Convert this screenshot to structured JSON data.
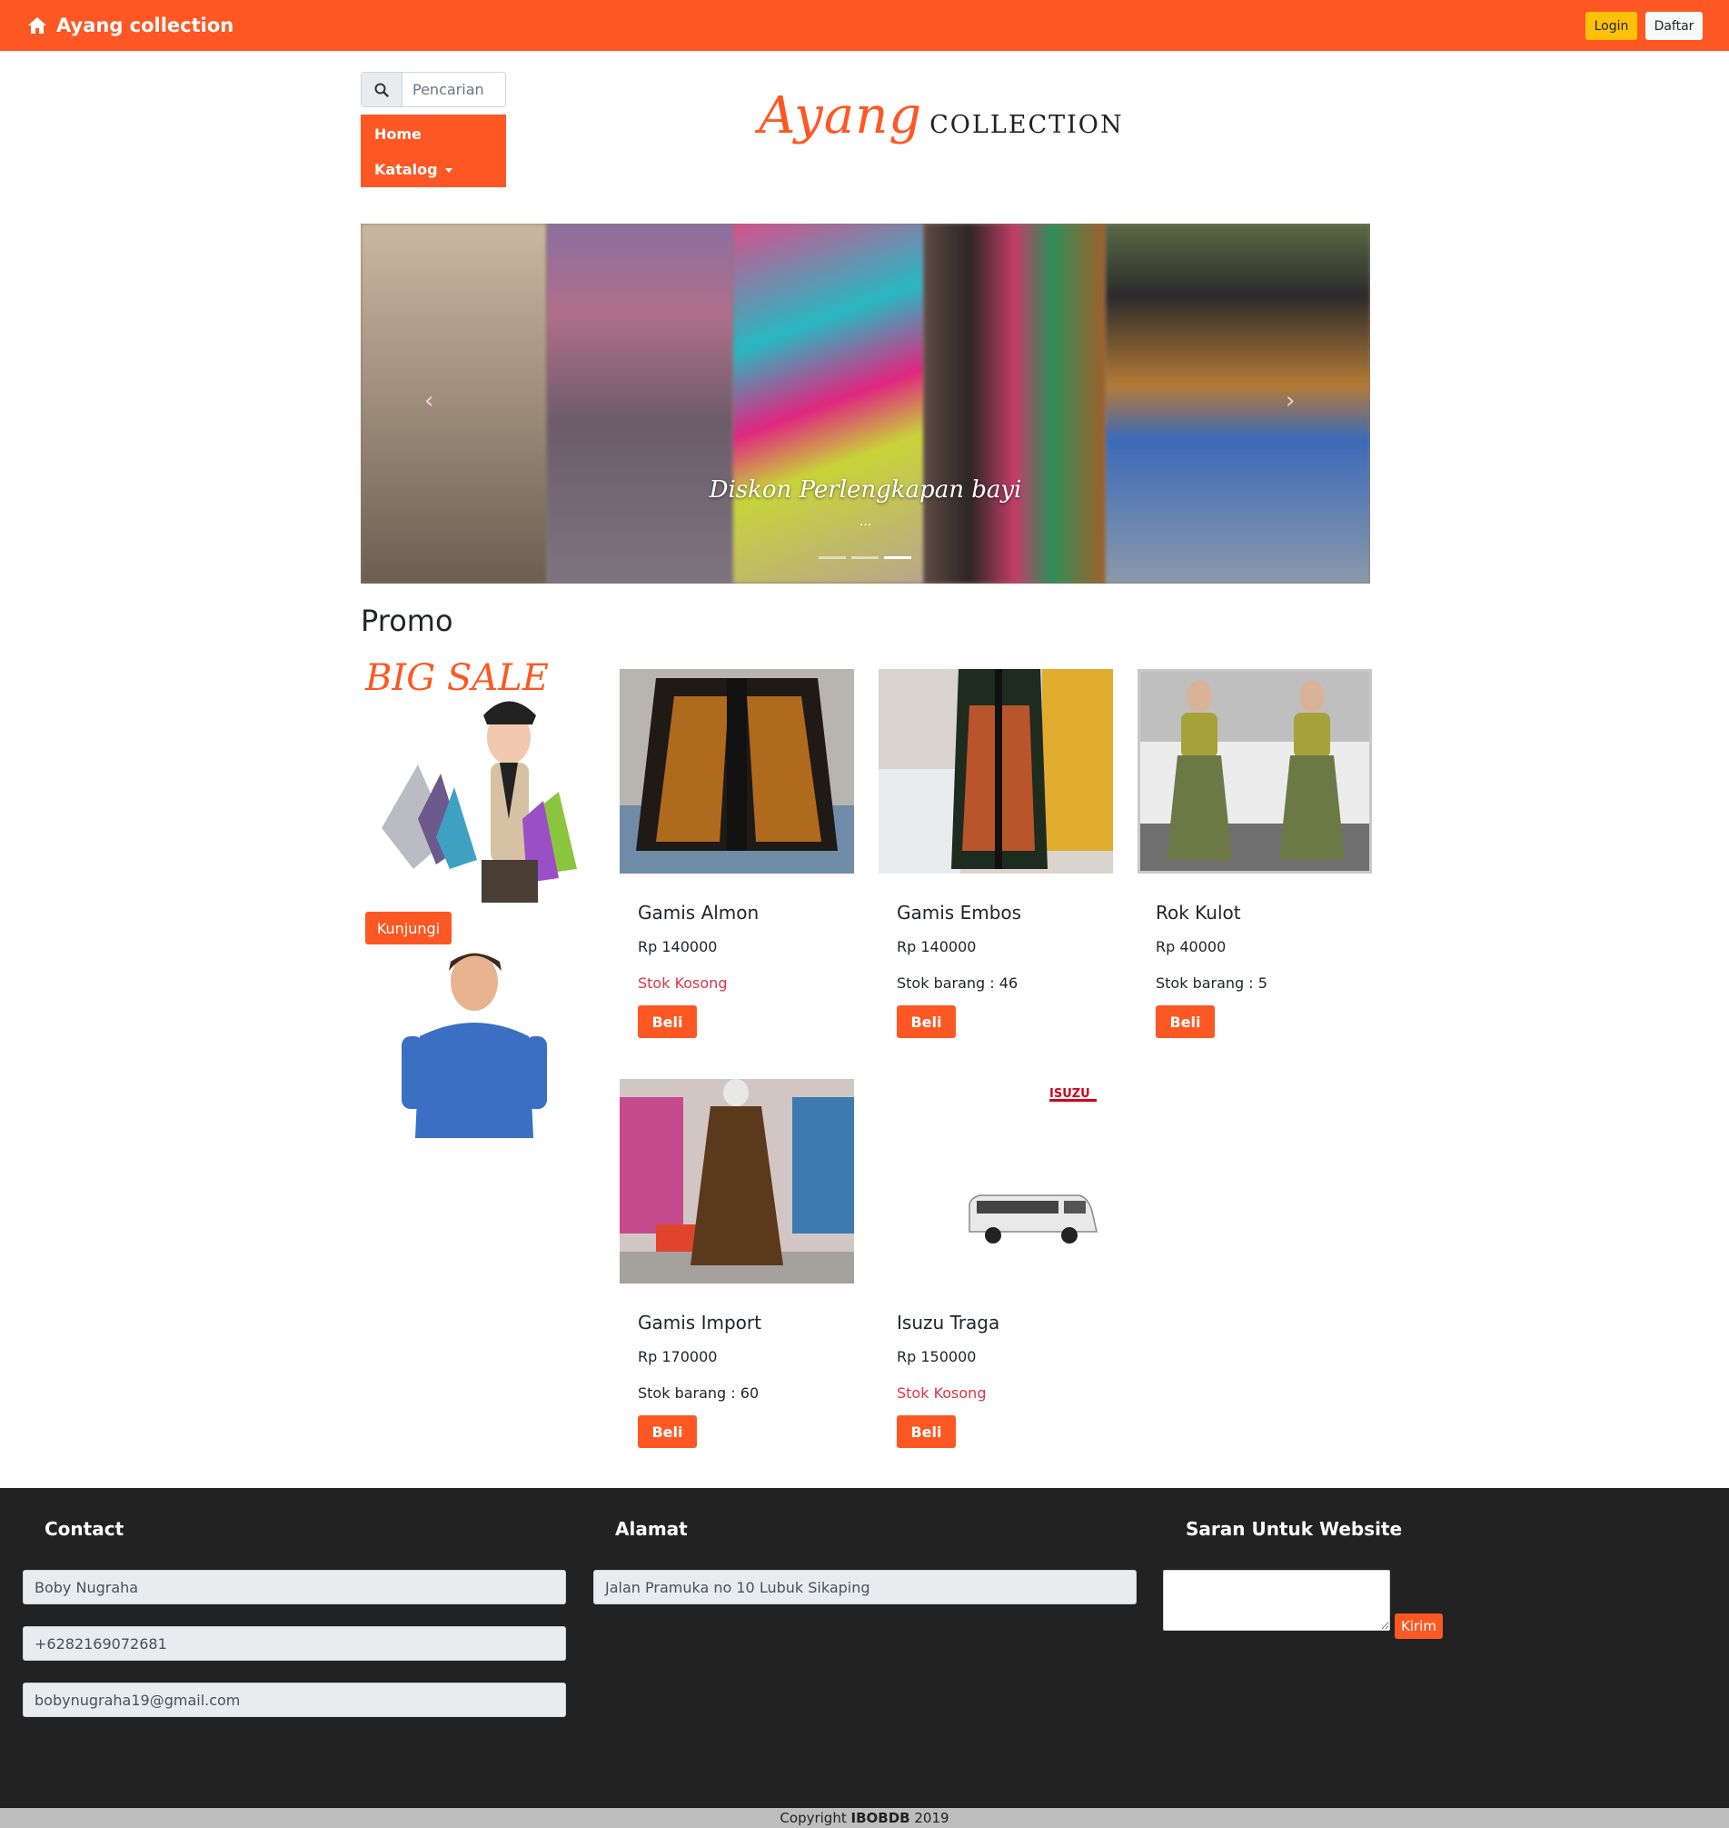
{
  "navbar": {
    "brand": "Ayang collection",
    "brand_icon": "home-icon",
    "login_label": "Login",
    "daftar_label": "Daftar",
    "color": "#fd5823"
  },
  "search": {
    "placeholder": "Pencarian",
    "icon": "search-icon"
  },
  "menu": {
    "home": "Home",
    "katalog": "Katalog"
  },
  "logo": {
    "part1": "Ayang",
    "part2": "collection"
  },
  "carousel": {
    "caption": "Diskon Perlengkapan bayi",
    "caption_sub": "...",
    "slide_count": 3,
    "active_index": 2
  },
  "promo": {
    "title": "Promo",
    "big_sale_text": "BIG SALE",
    "kunjungi_label": "Kunjungi"
  },
  "products": [
    {
      "name": "Gamis Almon",
      "price": "Rp 140000",
      "stock": "Stok Kosong",
      "in_stock": false,
      "button": "Beli"
    },
    {
      "name": "Gamis Embos",
      "price": "Rp 140000",
      "stock": "Stok barang : 46",
      "in_stock": true,
      "button": "Beli"
    },
    {
      "name": "Rok Kulot",
      "price": "Rp 40000",
      "stock": "Stok barang : 5",
      "in_stock": true,
      "button": "Beli"
    },
    {
      "name": "Gamis Import",
      "price": "Rp 170000",
      "stock": "Stok barang : 60",
      "in_stock": true,
      "button": "Beli"
    },
    {
      "name": "Isuzu Traga",
      "price": "Rp 150000",
      "stock": "Stok Kosong",
      "in_stock": false,
      "button": "Beli",
      "image_brand_text": "ISUZU"
    }
  ],
  "footer": {
    "contact_title": "Contact",
    "contact_name": "Boby Nugraha",
    "contact_phone": "+6282169072681",
    "contact_email": "bobynugraha19@gmail.com",
    "alamat_title": "Alamat",
    "alamat_value": "Jalan Pramuka no 10 Lubuk Sikaping",
    "saran_title": "Saran Untuk Website",
    "kirim_label": "Kirim",
    "copyright_prefix": "Copyright",
    "copyright_brand": "IBOBDB",
    "copyright_year": "2019"
  }
}
